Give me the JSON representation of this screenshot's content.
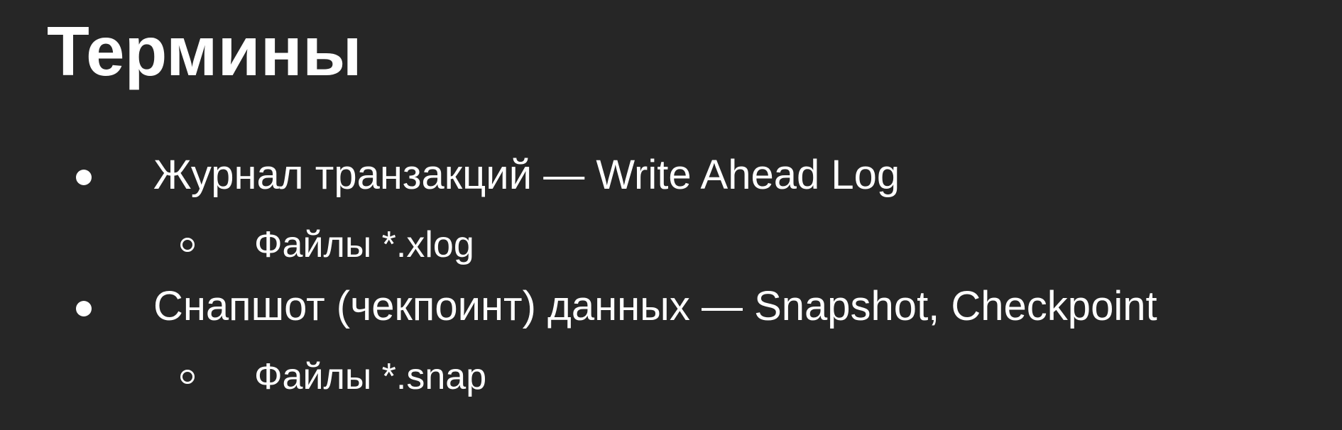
{
  "slide": {
    "title": "Термины",
    "items": [
      {
        "text": "Журнал транзакций — Write Ahead Log",
        "subitems": [
          "Файлы *.xlog"
        ]
      },
      {
        "text": "Снапшот (чекпоинт) данных — Snapshot, Checkpoint",
        "subitems": [
          "Файлы *.snap"
        ]
      }
    ]
  },
  "colors": {
    "background": "#262626",
    "text": "#ffffff"
  }
}
